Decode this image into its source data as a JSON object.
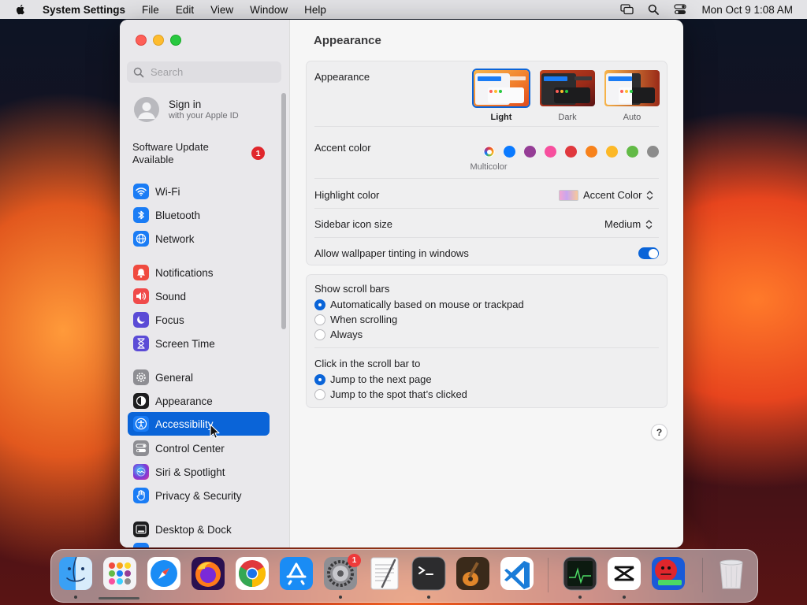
{
  "menubar": {
    "app_name": "System Settings",
    "menus": [
      "File",
      "Edit",
      "View",
      "Window",
      "Help"
    ],
    "clock": "Mon Oct 9  1:08 AM",
    "status_icons": [
      "display-mirroring-icon",
      "spotlight-search-icon",
      "control-center-icon"
    ]
  },
  "sidebar": {
    "search_placeholder": "Search",
    "account": {
      "title": "Sign in",
      "subtitle": "with your Apple ID"
    },
    "update": {
      "label": "Software Update Available",
      "badge": "1"
    },
    "groups": [
      {
        "items": [
          {
            "label": "Wi-Fi",
            "icon": "wifi-icon",
            "color": "#1a7cf5"
          },
          {
            "label": "Bluetooth",
            "icon": "bluetooth-icon",
            "color": "#1a7cf5"
          },
          {
            "label": "Network",
            "icon": "globe-icon",
            "color": "#1a7cf5"
          }
        ]
      },
      {
        "items": [
          {
            "label": "Notifications",
            "icon": "bell-icon",
            "color": "#f04a3f"
          },
          {
            "label": "Sound",
            "icon": "speaker-icon",
            "color": "#f04a4a"
          },
          {
            "label": "Focus",
            "icon": "moon-icon",
            "color": "#5b4bd6"
          },
          {
            "label": "Screen Time",
            "icon": "hourglass-icon",
            "color": "#5b4bd6"
          }
        ]
      },
      {
        "items": [
          {
            "label": "General",
            "icon": "gear-icon",
            "color": "#8e8e93"
          },
          {
            "label": "Appearance",
            "icon": "appearance-icon",
            "color": "#1d1d1f"
          },
          {
            "label": "Accessibility",
            "icon": "accessibility-icon",
            "color": "#1a7cf5",
            "selected": true
          },
          {
            "label": "Control Center",
            "icon": "toggles-icon",
            "color": "#8e8e93"
          },
          {
            "label": "Siri & Spotlight",
            "icon": "siri-icon",
            "color": "#7a3ad8"
          },
          {
            "label": "Privacy & Security",
            "icon": "hand-icon",
            "color": "#1a7cf5"
          }
        ]
      },
      {
        "items": [
          {
            "label": "Desktop & Dock",
            "icon": "dock-icon",
            "color": "#1d1d1f"
          }
        ]
      }
    ]
  },
  "content": {
    "title": "Appearance",
    "appearance": {
      "label": "Appearance",
      "options": [
        {
          "label": "Light",
          "selected": true
        },
        {
          "label": "Dark",
          "selected": false
        },
        {
          "label": "Auto",
          "selected": false
        }
      ]
    },
    "accent": {
      "label": "Accent color",
      "selected_caption": "Multicolor",
      "colors": [
        "multicolor",
        "#0a7aff",
        "#953d96",
        "#f74f9e",
        "#e0383e",
        "#f7821b",
        "#fcb827",
        "#62ba46",
        "#8c8c8c"
      ]
    },
    "highlight": {
      "label": "Highlight color",
      "value": "Accent Color"
    },
    "sidebar_icon_size": {
      "label": "Sidebar icon size",
      "value": "Medium"
    },
    "wallpaper_tinting": {
      "label": "Allow wallpaper tinting in windows",
      "on": true
    },
    "scroll_bars": {
      "label": "Show scroll bars",
      "options": [
        {
          "label": "Automatically based on mouse or trackpad",
          "selected": true
        },
        {
          "label": "When scrolling",
          "selected": false
        },
        {
          "label": "Always",
          "selected": false
        }
      ]
    },
    "click_scroll": {
      "label": "Click in the scroll bar to",
      "options": [
        {
          "label": "Jump to the next page",
          "selected": true
        },
        {
          "label": "Jump to the spot that’s clicked",
          "selected": false
        }
      ]
    },
    "help": "?"
  },
  "dock": {
    "apps": [
      "finder-icon",
      "launchpad-icon",
      "safari-icon",
      "firefox-icon",
      "chrome-icon",
      "app-store-icon",
      "system-settings-icon",
      "textedit-icon",
      "terminal-icon",
      "garageband-icon",
      "vscode-icon",
      "activity-monitor-icon",
      "capcut-icon",
      "app-icon",
      "trash-icon"
    ],
    "settings_badge": "1"
  }
}
